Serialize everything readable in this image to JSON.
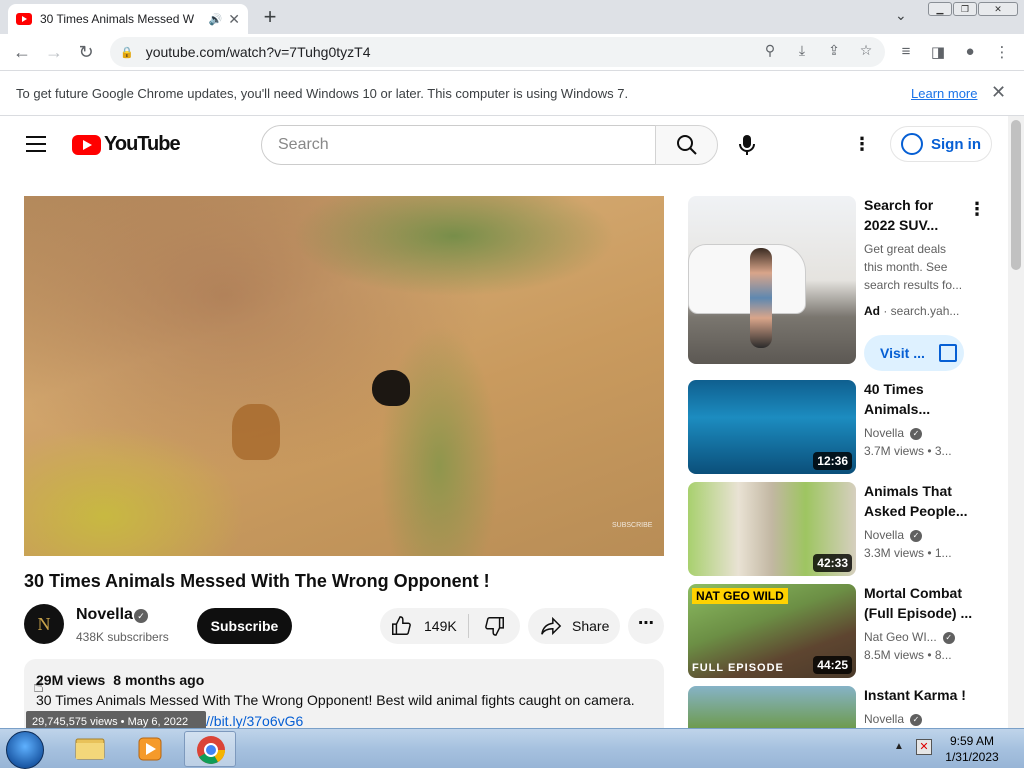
{
  "browser": {
    "tab_title": "30 Times Animals Messed W",
    "url": "youtube.com/watch?v=7Tuhg0tyzT4",
    "infobar_message": "To get future Google Chrome updates, you'll need Windows 10 or later. This computer is using Windows 7.",
    "infobar_link": "Learn more"
  },
  "youtube": {
    "logo_text": "YouTube",
    "search_placeholder": "Search",
    "sign_in_label": "Sign in"
  },
  "video": {
    "title": "30 Times Animals Messed With The Wrong Opponent !",
    "watermark": "SUBSCRIBE",
    "channel_initial": "N",
    "channel_name": "Novella",
    "subscribers": "438K subscribers",
    "subscribe_label": "Subscribe",
    "likes": "149K",
    "share_label": "Share",
    "views_short": "29M views",
    "age": "8 months ago",
    "description": "30 Times Animals Messed With The Wrong Opponent! Best wild animal fights caught on camera.",
    "description_link": "//bit.ly/37o6vG6",
    "tooltip": "29,745,575 views • May 6, 2022"
  },
  "sidebar": {
    "ad": {
      "title_line1": "Search for",
      "title_line2": "2022 SUV...",
      "desc_line1": "Get great deals",
      "desc_line2": "this month. See",
      "desc_line3": "search results fo...",
      "ad_label": "Ad",
      "source": "search.yah...",
      "visit_label": "Visit ..."
    },
    "items": [
      {
        "title_line1": "40 Times",
        "title_line2": "Animals...",
        "channel": "Novella",
        "stats": "3.7M views  • 3...",
        "duration": "12:36"
      },
      {
        "title_line1": "Animals That",
        "title_line2": "Asked People...",
        "channel": "Novella",
        "stats": "3.3M views  • 1...",
        "duration": "42:33"
      },
      {
        "title_line1": "Mortal Combat",
        "title_line2": "(Full Episode) ...",
        "channel": "Nat Geo WI...",
        "stats": "8.5M views  • 8...",
        "duration": "44:25",
        "badge": "NAT GEO WILD",
        "overlay": "FULL EPISODE"
      },
      {
        "title_line1": "Instant Karma !",
        "channel": "Novella"
      }
    ]
  },
  "taskbar": {
    "time": "9:59 AM",
    "date": "1/31/2023"
  }
}
